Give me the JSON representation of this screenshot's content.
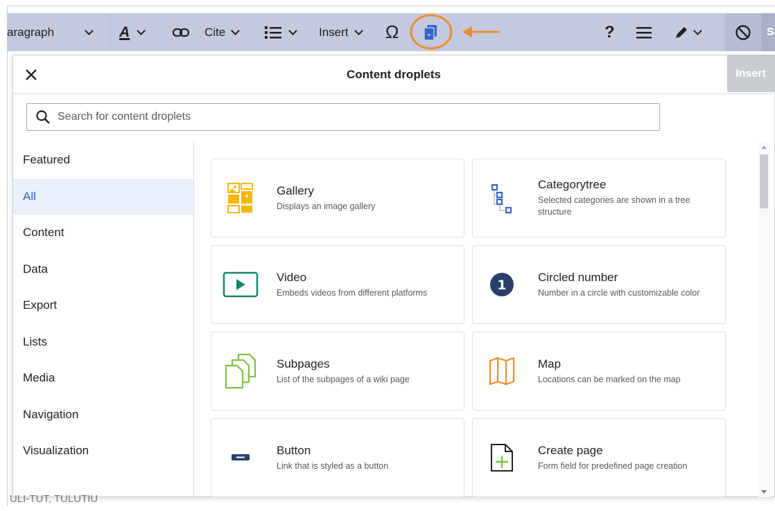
{
  "toolbar": {
    "paragraph_label": "aragraph",
    "cite_label": "Cite",
    "insert_label": "Insert",
    "help_label": "?",
    "save_label": "Sa",
    "accent_color": "#3366cc",
    "highlight_color": "#f28c28"
  },
  "dialog": {
    "title": "Content droplets",
    "insert_label": "Insert",
    "search_placeholder": "Search for content droplets"
  },
  "sidebar": {
    "items": [
      {
        "label": "Featured",
        "active": false
      },
      {
        "label": "All",
        "active": true
      },
      {
        "label": "Content",
        "active": false
      },
      {
        "label": "Data",
        "active": false
      },
      {
        "label": "Export",
        "active": false
      },
      {
        "label": "Lists",
        "active": false
      },
      {
        "label": "Media",
        "active": false
      },
      {
        "label": "Navigation",
        "active": false
      },
      {
        "label": "Visualization",
        "active": false
      }
    ]
  },
  "droplets": [
    {
      "name": "Gallery",
      "desc": "Displays an image gallery",
      "icon": "gallery-icon"
    },
    {
      "name": "Categorytree",
      "desc": "Selected categories are shown in a tree structure",
      "icon": "category-tree-icon"
    },
    {
      "name": "Video",
      "desc": "Embeds videos from different platforms",
      "icon": "video-icon"
    },
    {
      "name": "Circled number",
      "desc": "Number in a circle with customizable color",
      "icon": "circled-number-icon",
      "icon_text": "1"
    },
    {
      "name": "Subpages",
      "desc": "List of the subpages of a wiki page",
      "icon": "subpages-icon"
    },
    {
      "name": "Map",
      "desc": "Locations can be marked on the map",
      "icon": "map-icon"
    },
    {
      "name": "Button",
      "desc": "Link that is styled as a button",
      "icon": "button-icon"
    },
    {
      "name": "Create page",
      "desc": "Form field for predefined page creation",
      "icon": "create-page-icon"
    }
  ],
  "background": {
    "partial_text": "ULI-TUT, TULUTIU"
  }
}
